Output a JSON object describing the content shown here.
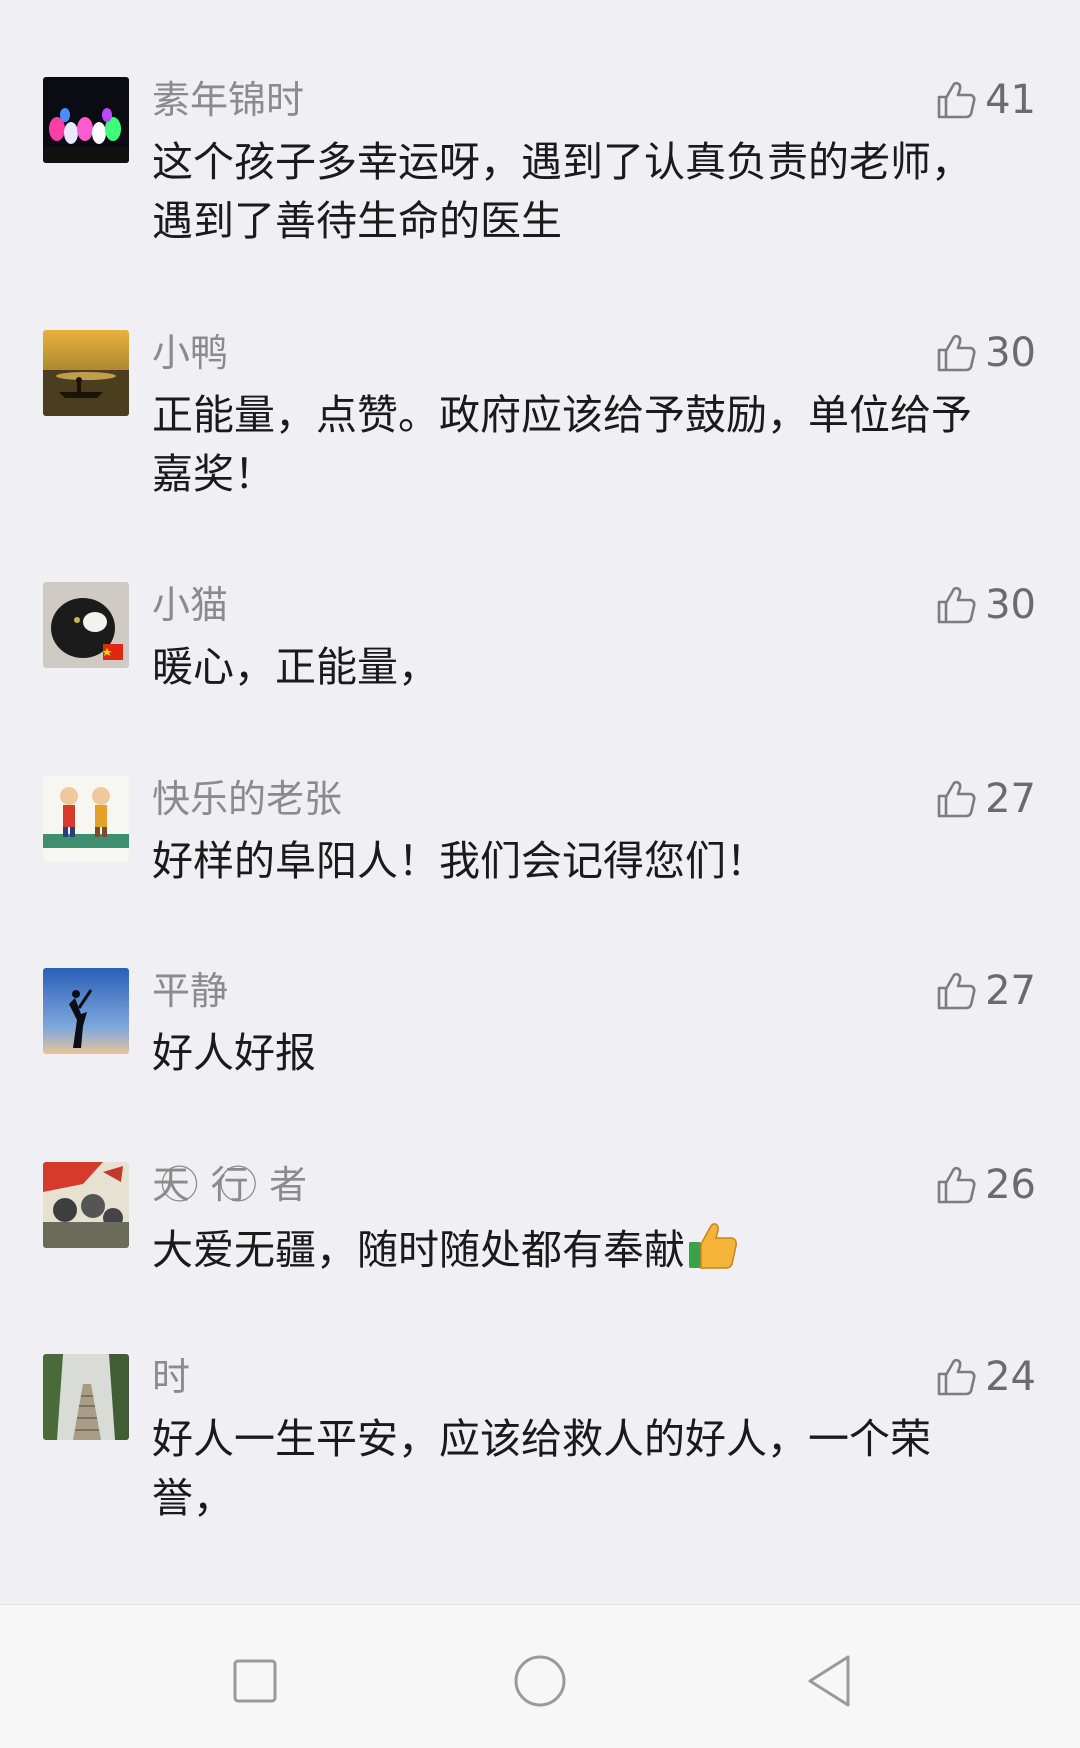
{
  "comments": [
    {
      "name": "素年锦时",
      "likes": "41",
      "text": "这个孩子多幸运呀，遇到了认真负责的老师，遇到了善待生命的医生"
    },
    {
      "name": "小鸭",
      "likes": "30",
      "text": "正能量，点赞。政府应该给予鼓励，单位给予嘉奖！"
    },
    {
      "name": "小猫",
      "likes": "30",
      "text": "暖心，正能量，"
    },
    {
      "name": "快乐的老张",
      "likes": "27",
      "text": "好样的阜阳人！我们会记得您们！"
    },
    {
      "name": "平静",
      "likes": "27",
      "text": "好人好报"
    },
    {
      "name": "天 ⃝ 行 ⃝ 者",
      "likes": "26",
      "text": "大爱无疆，随时随处都有奉献"
    },
    {
      "name": "时",
      "likes": "24",
      "text": "好人一生平安，应该给救人的好人，一个荣誉，"
    }
  ],
  "icons": {
    "like": "thumbs-up-outline-icon",
    "emoji": "thumbs-up-emoji-icon",
    "nav_recent": "square-icon",
    "nav_home": "circle-icon",
    "nav_back": "triangle-back-icon"
  },
  "colors": {
    "background": "#efeff4",
    "name": "#8b8b8b",
    "text": "#1a1a1a",
    "like": "#6b6b6b"
  }
}
